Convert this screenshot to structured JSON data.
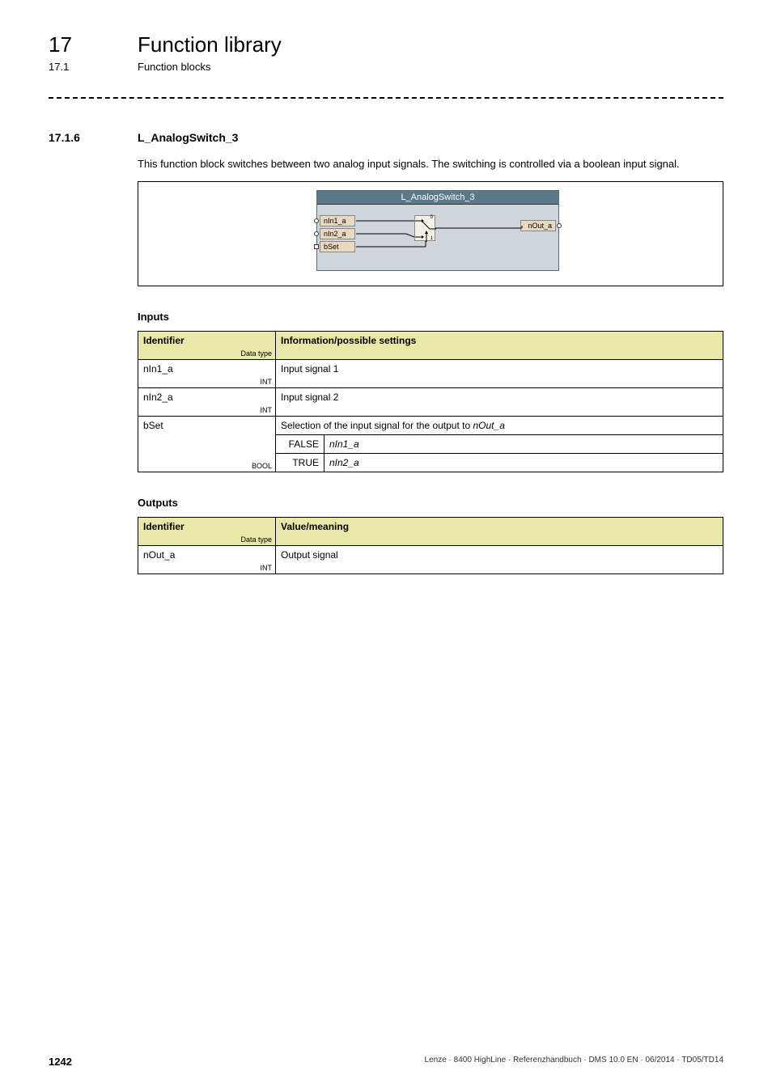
{
  "header": {
    "chapter_num": "17",
    "chapter_title": "Function library",
    "sub_num": "17.1",
    "sub_title": "Function blocks"
  },
  "section": {
    "num": "17.1.6",
    "title": "L_AnalogSwitch_3",
    "description": "This function block switches between two analog input signals. The switching is controlled via a boolean input signal."
  },
  "diagram": {
    "title": "L_AnalogSwitch_3",
    "in1": "nIn1_a",
    "in2": "nIn2_a",
    "in3": "bSet",
    "out": "nOut_a",
    "sw_top": "0",
    "sw_bot": "1"
  },
  "inputs_heading": "Inputs",
  "inputs_table": {
    "h_ident": "Identifier",
    "h_datatype": "Data type",
    "h_info": "Information/possible settings",
    "rows": [
      {
        "ident": "nIn1_a",
        "dtype": "INT",
        "info": "Input signal 1"
      },
      {
        "ident": "nIn2_a",
        "dtype": "INT",
        "info": "Input signal 2"
      }
    ],
    "bset": {
      "ident": "bSet",
      "dtype": "BOOL",
      "info": "Selection of the input signal for the output to ",
      "info_italic": "nOut_a",
      "val_false": "FALSE",
      "val_false_desc": "nIn1_a",
      "val_true": "TRUE",
      "val_true_desc": "nIn2_a"
    }
  },
  "outputs_heading": "Outputs",
  "outputs_table": {
    "h_ident": "Identifier",
    "h_datatype": "Data type",
    "h_info": "Value/meaning",
    "row": {
      "ident": "nOut_a",
      "dtype": "INT",
      "info": "Output signal"
    }
  },
  "footer": {
    "page": "1242",
    "right": "Lenze · 8400 HighLine · Referenzhandbuch · DMS 10.0 EN · 06/2014 · TD05/TD14"
  }
}
